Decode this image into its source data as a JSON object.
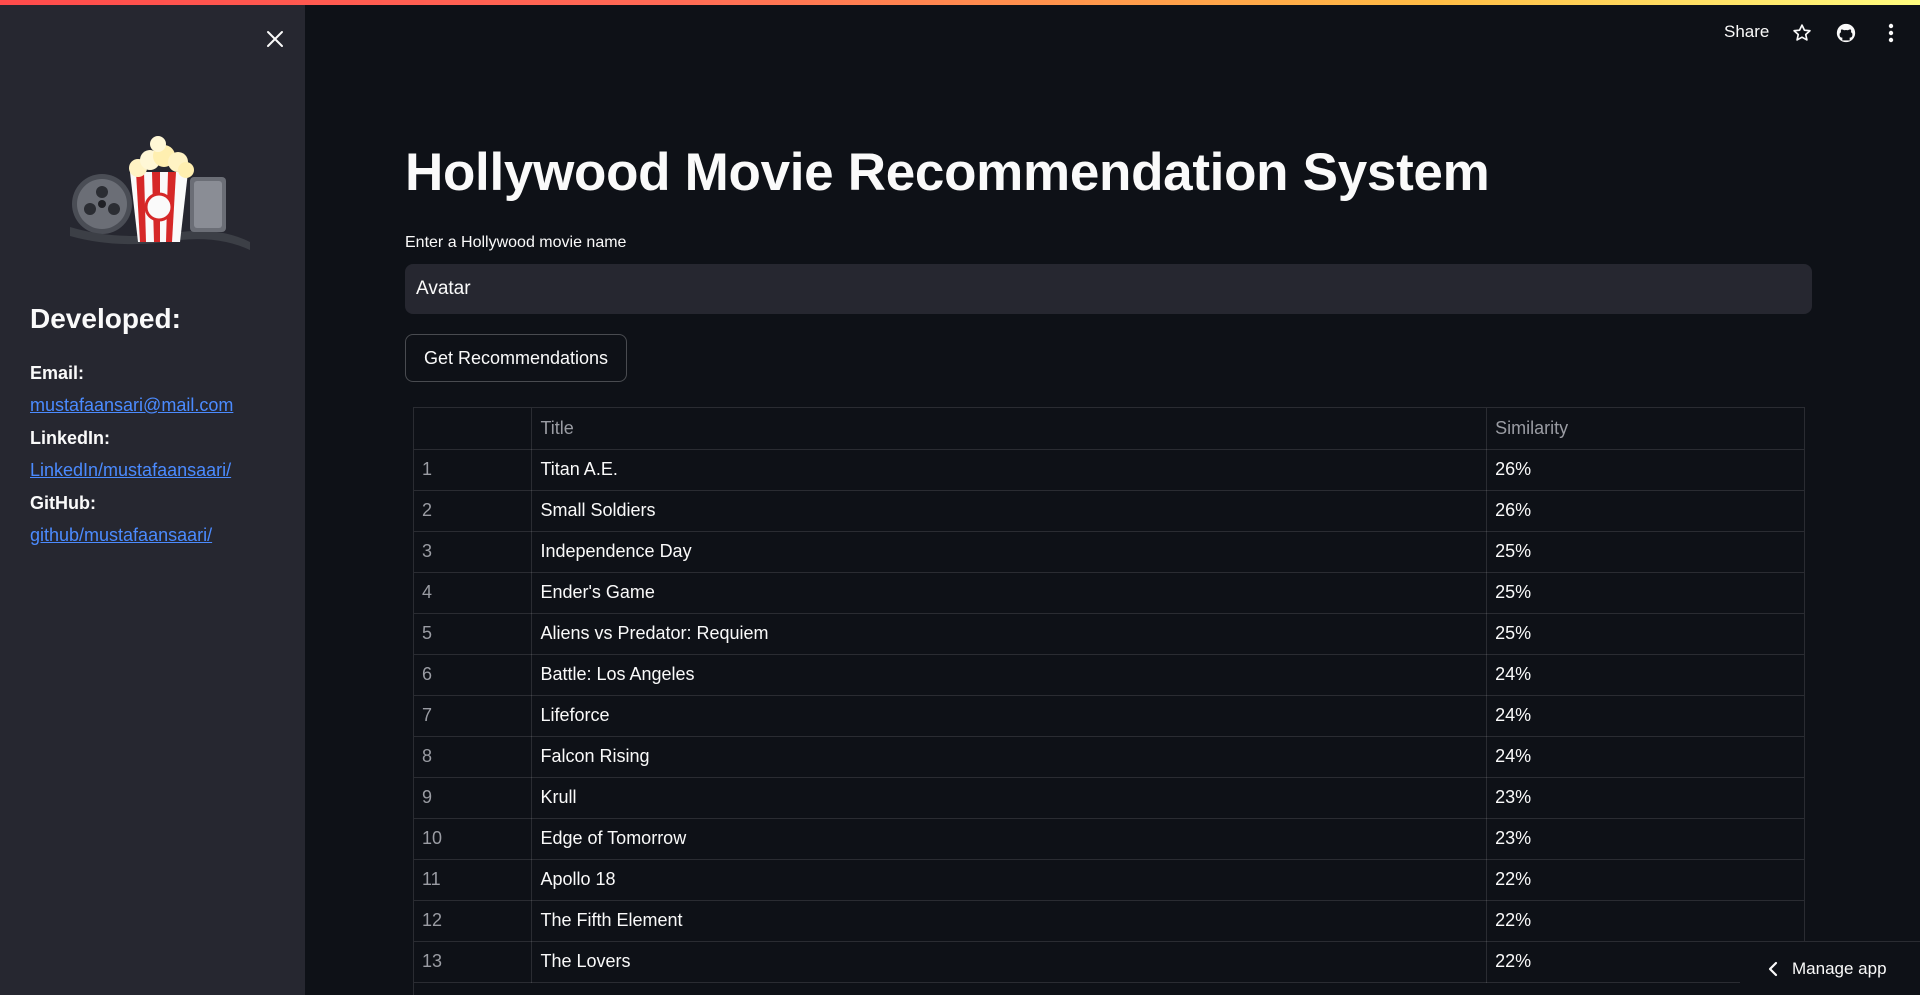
{
  "header": {
    "share_label": "Share",
    "icons": [
      "star-icon",
      "github-icon",
      "more-vert-icon"
    ]
  },
  "sidebar": {
    "close_icon": "close-icon",
    "logo": "popcorn-film-reel-logo",
    "heading": "Developed:",
    "email_label": "Email:",
    "email_link": "mustafaansari@mail.com",
    "linkedin_label": "LinkedIn:",
    "linkedin_link": "LinkedIn/mustafaansaari/",
    "github_label": "GitHub:",
    "github_link": "github/mustafaansaari/"
  },
  "main": {
    "title": "Hollywood Movie Recommendation System",
    "input_label": "Enter a Hollywood movie name",
    "input_value": "Avatar",
    "button_label": "Get Recommendations",
    "table": {
      "columns": [
        "",
        "Title",
        "Similarity"
      ],
      "rows": [
        [
          "1",
          "Titan A.E.",
          "26%"
        ],
        [
          "2",
          "Small Soldiers",
          "26%"
        ],
        [
          "3",
          "Independence Day",
          "25%"
        ],
        [
          "4",
          "Ender's Game",
          "25%"
        ],
        [
          "5",
          "Aliens vs Predator: Requiem",
          "25%"
        ],
        [
          "6",
          "Battle: Los Angeles",
          "24%"
        ],
        [
          "7",
          "Lifeforce",
          "24%"
        ],
        [
          "8",
          "Falcon Rising",
          "24%"
        ],
        [
          "9",
          "Krull",
          "23%"
        ],
        [
          "10",
          "Edge of Tomorrow",
          "23%"
        ],
        [
          "11",
          "Apollo 18",
          "22%"
        ],
        [
          "12",
          "The Fifth Element",
          "22%"
        ],
        [
          "13",
          "The Lovers",
          "22%"
        ]
      ]
    }
  },
  "footer": {
    "manage_label": "Manage app",
    "manage_icon": "chevron-left-icon"
  }
}
